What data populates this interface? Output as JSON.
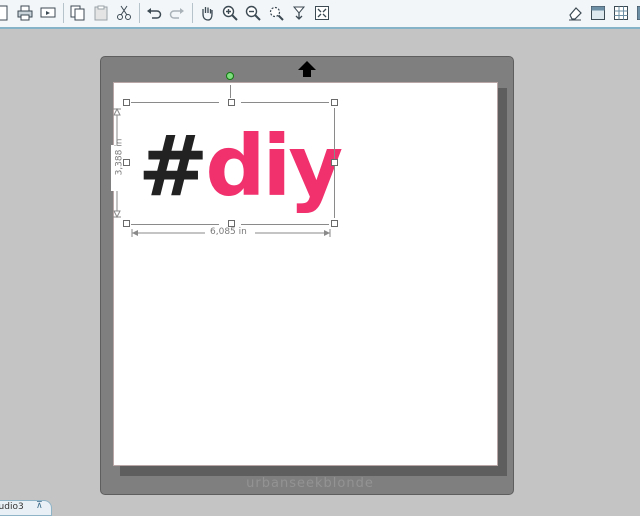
{
  "toolbar": {
    "left_buttons": [
      {
        "icon": "new-icon"
      },
      {
        "icon": "print-icon"
      },
      {
        "icon": "send-icon"
      },
      {
        "icon": "copy-icon"
      },
      {
        "icon": "paste-icon"
      },
      {
        "icon": "cut-icon"
      },
      {
        "icon": "undo-icon"
      },
      {
        "icon": "redo-icon"
      },
      {
        "icon": "pan-hand-icon"
      },
      {
        "icon": "zoom-in-icon"
      },
      {
        "icon": "zoom-out-icon"
      },
      {
        "icon": "zoom-select-icon"
      },
      {
        "icon": "fit-to-page-icon"
      },
      {
        "icon": "zoom-to-fit-icon"
      }
    ],
    "right_buttons": [
      {
        "icon": "eraser-icon"
      },
      {
        "icon": "page-settings-icon"
      },
      {
        "icon": "grid-icon"
      },
      {
        "icon": "panel-icon"
      }
    ]
  },
  "canvas": {
    "design_hash": "#",
    "design_word": "diy",
    "width_label": "6,085 in",
    "height_label": "3,388 in",
    "watermark": "urbanseekblonde"
  },
  "document_tab": {
    "label": "tudio3",
    "pin": "⊼"
  },
  "colors": {
    "toolbar_bg": "#f3f6f8",
    "toolbar_border": "#86b3c8",
    "workspace_bg": "#c4c4c4",
    "device_gray": "#7f7f7f",
    "design_dark": "#222222",
    "design_pink": "#f0316e"
  }
}
